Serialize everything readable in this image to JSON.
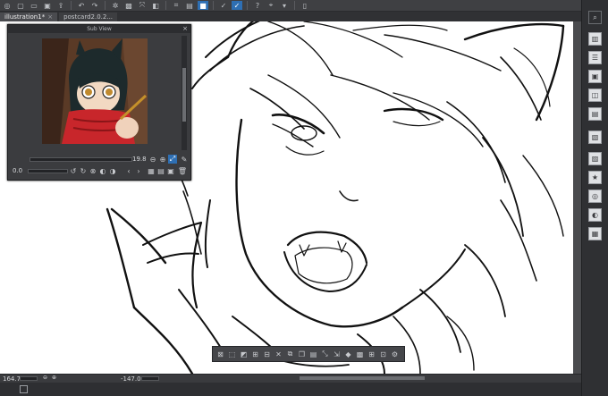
{
  "tabs": [
    {
      "label": "illustration1*",
      "active": true
    },
    {
      "label": "postcard2.0.2...",
      "active": false
    }
  ],
  "subview": {
    "title": "Sub View",
    "close": "×",
    "zoom_value": "19.8",
    "rotation_value": "0.0"
  },
  "statusbar": {
    "zoom": "164.7",
    "rotation": "-147.0"
  },
  "colors": {
    "accent": "#2e6fb3",
    "canvas": "#ffffff",
    "panel": "#3b3c3f"
  }
}
